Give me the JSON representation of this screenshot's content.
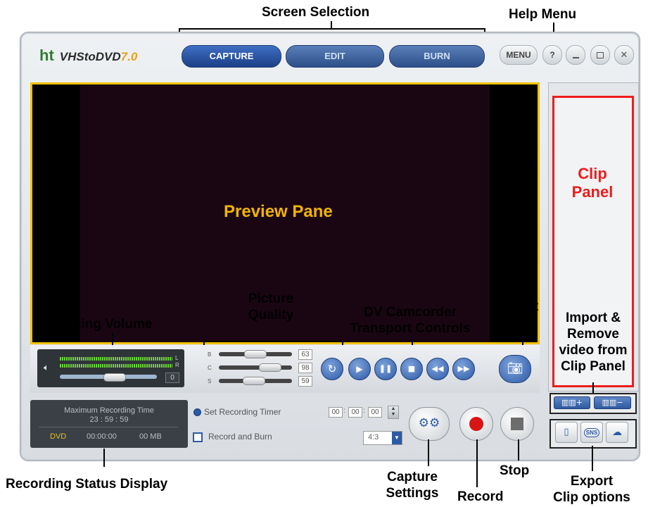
{
  "app": {
    "logo_ht": "ht",
    "logo_name": "VHStoDVD",
    "logo_version": "7.0"
  },
  "tabs": [
    {
      "label": "CAPTURE",
      "active": true
    },
    {
      "label": "EDIT",
      "active": false
    },
    {
      "label": "BURN",
      "active": false
    }
  ],
  "window_buttons": {
    "menu": "MENU",
    "help": "?",
    "minimize_icon": "minimize-icon",
    "maximize_icon": "maximize-icon",
    "close_icon": "close-icon"
  },
  "picture_quality": {
    "brightness": {
      "label": "B",
      "value": "63"
    },
    "contrast": {
      "label": "C",
      "value": "98"
    },
    "saturation": {
      "label": "S",
      "value": "59"
    }
  },
  "volume": {
    "left_label": "L",
    "right_label": "R",
    "value": "0"
  },
  "status": {
    "title": "Maximum Recording Time",
    "time": "23 : 59 : 59",
    "media": "DVD",
    "elapsed": "00:00:00",
    "size": "00 MB"
  },
  "recording": {
    "set_timer_label": "Set Recording Timer",
    "record_and_burn_label": "Record and Burn",
    "timer_h": "00",
    "timer_m": "00",
    "timer_s": "00",
    "aspect": "4:3"
  },
  "callouts": {
    "screen_selection": "Screen Selection",
    "help_menu": "Help Menu",
    "preview_pane": "Preview Pane",
    "clip_panel": "Clip Panel",
    "picture_quality": "Picture Quality",
    "still_shot": "Still Shot",
    "dv_transport": "DV Camcorder Transport Controls",
    "recording_volume": "Recording Volume",
    "import_remove": "Import & Remove video from Clip Panel",
    "recording_status": "Recording Status Display",
    "capture_settings": "Capture Settings",
    "record": "Record",
    "stop": "Stop",
    "export": "Export Clip options"
  },
  "export_buttons": {
    "sns": "SNS"
  },
  "colors": {
    "preview_border": "#f2c200",
    "preview_text": "#f2b400",
    "clip_panel_border": "#ee1c1c",
    "clip_panel_text": "#ee1c1c",
    "tab_active": "#1c3f87",
    "record_red": "#d81515"
  }
}
